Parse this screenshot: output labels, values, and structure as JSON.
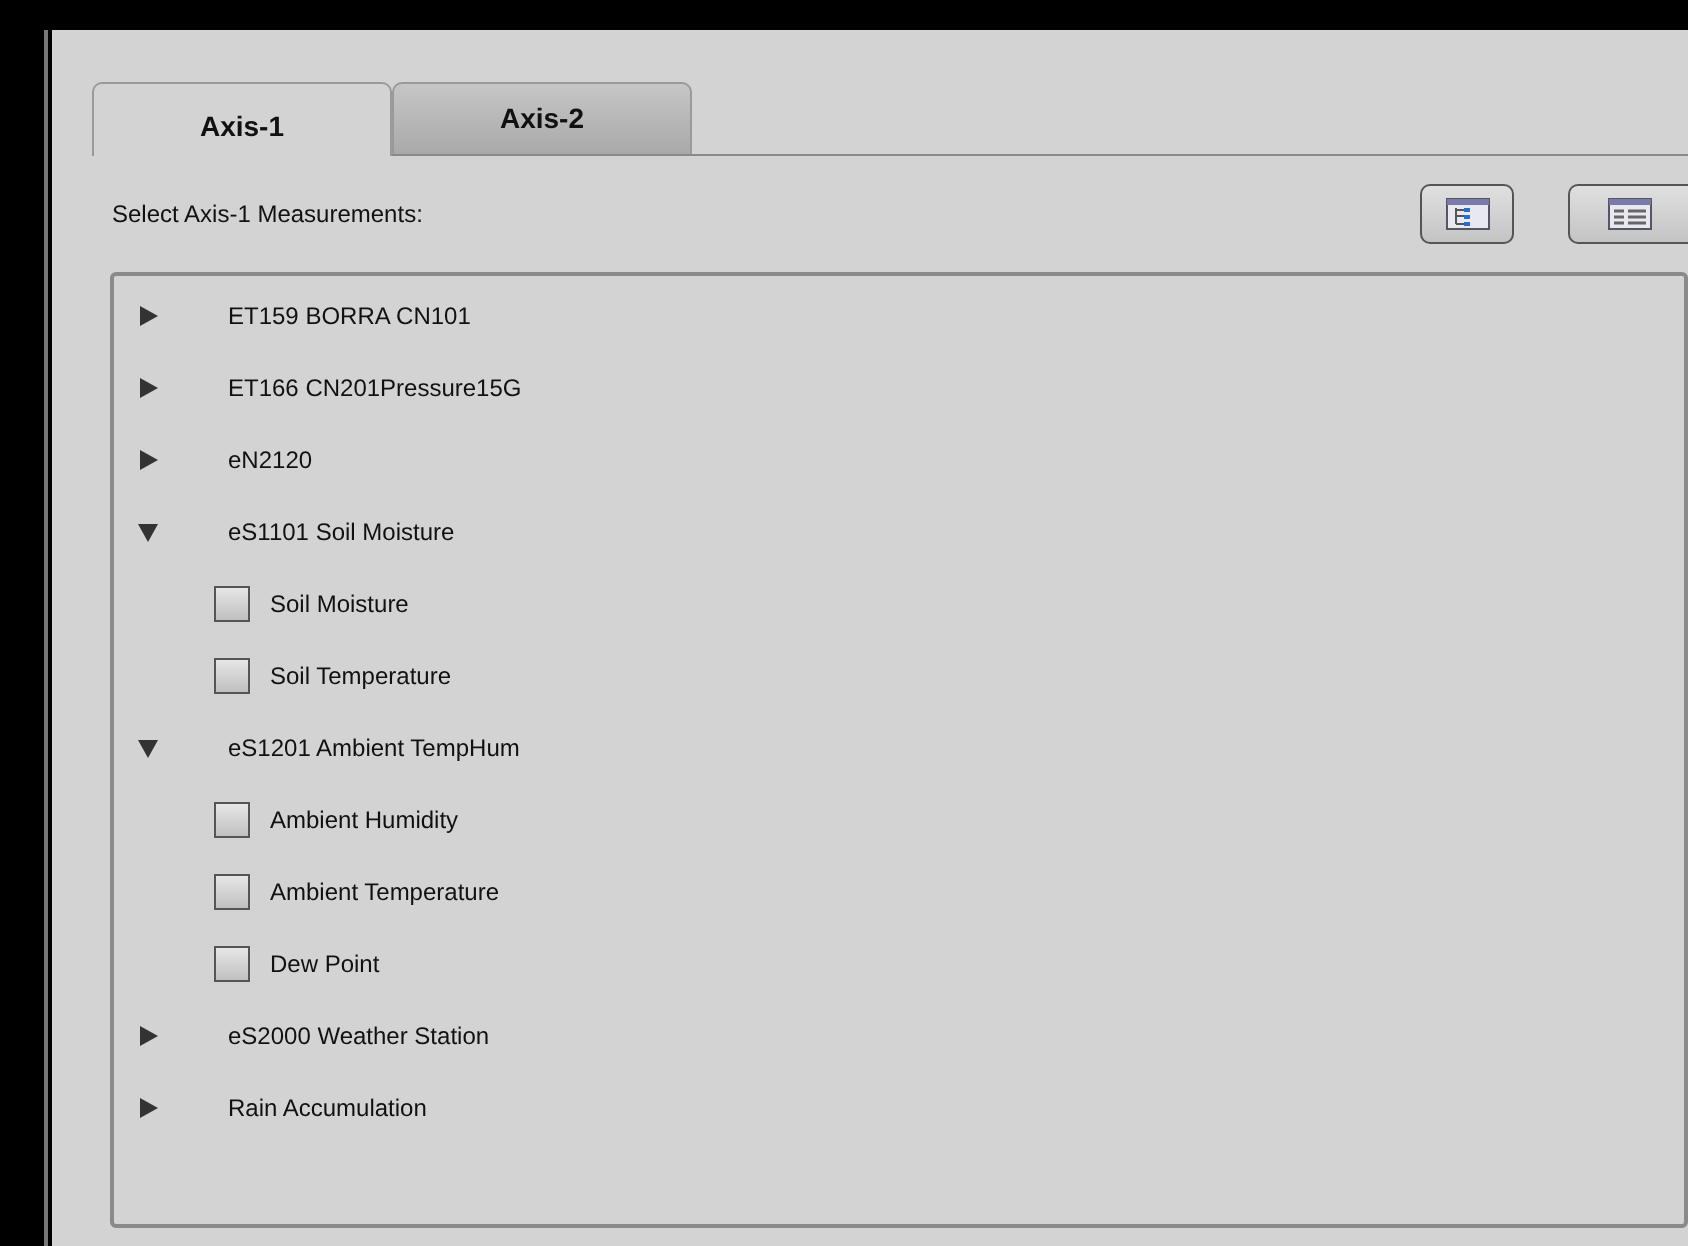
{
  "tabs": [
    {
      "label": "Axis-1",
      "selected": true
    },
    {
      "label": "Axis-2",
      "selected": false
    }
  ],
  "prompt": "Select Axis-1 Measurements:",
  "tree": [
    {
      "label": "ET159 BORRA CN101",
      "expanded": false
    },
    {
      "label": "ET166 CN201Pressure15G",
      "expanded": false
    },
    {
      "label": "eN2120",
      "expanded": false
    },
    {
      "label": "eS1101 Soil Moisture",
      "expanded": true,
      "children": [
        {
          "label": "Soil Moisture",
          "checked": false
        },
        {
          "label": "Soil Temperature",
          "checked": false
        }
      ]
    },
    {
      "label": "eS1201 Ambient TempHum",
      "expanded": true,
      "children": [
        {
          "label": "Ambient Humidity",
          "checked": false
        },
        {
          "label": "Ambient Temperature",
          "checked": false
        },
        {
          "label": "Dew Point",
          "checked": false
        }
      ]
    },
    {
      "label": "eS2000 Weather Station",
      "expanded": false
    },
    {
      "label": "Rain Accumulation",
      "expanded": false
    }
  ]
}
